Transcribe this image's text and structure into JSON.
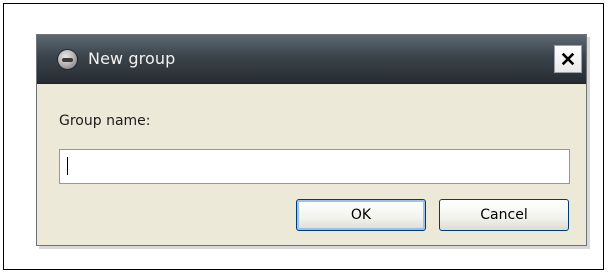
{
  "dialog": {
    "title": "New group",
    "icon": "app-logo-icon",
    "close_icon": "close-icon"
  },
  "form": {
    "group_name_label": "Group name:",
    "group_name_value": "",
    "group_name_placeholder": ""
  },
  "buttons": {
    "ok_label": "OK",
    "cancel_label": "Cancel"
  },
  "colors": {
    "titlebar": "#3b434b",
    "dialog_background": "#ece9d8",
    "input_border": "#7f9db9",
    "button_border": "#003c74"
  }
}
